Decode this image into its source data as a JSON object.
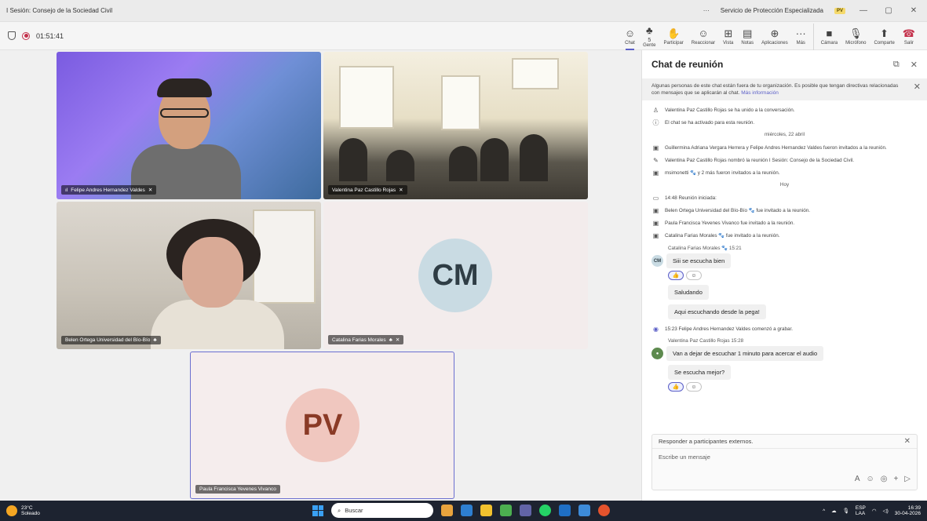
{
  "window": {
    "title": "I Sesión: Consejo de la Sociedad Civil",
    "more": "···",
    "org": "Servicio de Protección Especializada",
    "badge": "PV",
    "minimize": "—",
    "restore": "▢",
    "close": "✕"
  },
  "meeting": {
    "timer": "01:51:41"
  },
  "toolbar": [
    {
      "name": "chat",
      "label": "Chat",
      "icon": "☺",
      "active": true
    },
    {
      "name": "people",
      "label": "Gente",
      "icon": "♣",
      "count": "5"
    },
    {
      "name": "raise-hand",
      "label": "Participar",
      "icon": "✋"
    },
    {
      "name": "react",
      "label": "Reaccionar",
      "icon": "☺"
    },
    {
      "name": "view",
      "label": "Vista",
      "icon": "⊞"
    },
    {
      "name": "notes",
      "label": "Notas",
      "icon": "▤"
    },
    {
      "name": "apps",
      "label": "Aplicaciones",
      "icon": "⊕"
    },
    {
      "name": "more",
      "label": "Más",
      "icon": "···"
    },
    {
      "name": "camera",
      "label": "Cámara",
      "icon": "■"
    },
    {
      "name": "mic",
      "label": "Micrófono",
      "icon": "🎙"
    },
    {
      "name": "share",
      "label": "Comparte",
      "icon": "⬆"
    },
    {
      "name": "leave",
      "label": "Salir",
      "icon": "☎"
    }
  ],
  "tiles": {
    "t1": "Felipe Andres Hernandez Valdes",
    "t2": "Valentina Paz Castillo Rojas",
    "t3": "Belen Ortega Universidad del Bío-Bío",
    "t4": "Catalina Farias Morales",
    "t4_initials": "CM",
    "t5": "Paula Francisca Yevenes Vivanco",
    "t5_initials": "PV"
  },
  "chat": {
    "title": "Chat de reunión",
    "notice": "Algunas personas de este chat están fuera de tu organización. Es posible que tengan directivas relacionadas con mensajes que se aplicarán al chat.",
    "notice_link": "Más información",
    "events_before": [
      {
        "icon": "♙",
        "text": "Valentina Paz Castillo Rojas se ha unido a la conversación."
      },
      {
        "icon": "ⓘ",
        "text": "El chat se ha activado para esta reunión."
      }
    ],
    "day1": "miércoles, 22 abril",
    "events_day1": [
      {
        "icon": "▣",
        "text": "Guillermina Adriana Vergara Herrera y Felipe Andres Hernandez Valdes fueron invitados a la reunión."
      },
      {
        "icon": "✎",
        "text": "Valentina Paz Castillo Rojas nombró la reunión I Sesión: Consejo de la Sociedad Civil."
      },
      {
        "icon": "▣",
        "text": "msimonetti 🐾 y 2 más fueron invitados a la reunión."
      }
    ],
    "day2": "Hoy",
    "events_today": [
      {
        "icon": "▭",
        "text": "14:48  Reunión iniciada:"
      },
      {
        "icon": "▣",
        "text": "Belen Ortega Universidad del Bío-Bío 🐾 fue invitado a la reunión."
      },
      {
        "icon": "▣",
        "text": "Paula Francisca Yevenes Vivanco fue invitado a la reunión."
      },
      {
        "icon": "▣",
        "text": "Catalina Farias Morales 🐾 fue invitado a la reunión."
      }
    ],
    "sender1": "Catalina Farias Morales 🐾  15:21",
    "sender1_initials": "CM",
    "msg1": "Siii se escucha bien",
    "msg2": "Saludando",
    "msg3": "Aqui escuchando desde la pega!",
    "record_event": "15:23  Felipe Andres Hernandez Valdes comenzó a grabar.",
    "sender2": "Valentina Paz Castillo Rojas  15:28",
    "msg4": "Van a dejar de escuchar 1 minuto para acercar el audio",
    "msg5": "Se escucha mejor?",
    "reaction": "👍",
    "compose_ext": "Responder a participantes externos.",
    "compose_placeholder": "Escribe un mensaje"
  },
  "taskbar": {
    "temp": "23°C",
    "weather": "Soleado",
    "search": "Buscar",
    "lang1": "ESP",
    "lang2": "LAA",
    "time": "16:39",
    "date": "30-04-2026"
  }
}
